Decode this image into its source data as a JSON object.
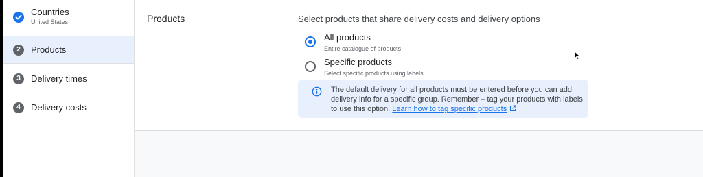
{
  "sidebar": {
    "steps": [
      {
        "label": "Countries",
        "sub": "United States",
        "state": "done",
        "icon": "check-icon"
      },
      {
        "label": "Products",
        "number": "2",
        "state": "active"
      },
      {
        "label": "Delivery times",
        "number": "3",
        "state": "pending"
      },
      {
        "label": "Delivery costs",
        "number": "4",
        "state": "pending"
      }
    ]
  },
  "main": {
    "section_title": "Products",
    "question": "Select products that share delivery costs and delivery options",
    "options": [
      {
        "label": "All products",
        "sub": "Entire catalogue of products",
        "selected": true
      },
      {
        "label": "Specific products",
        "sub": "Select specific products using labels",
        "selected": false
      }
    ],
    "info": {
      "icon": "info-icon",
      "text": "The default delivery for all products must be entered before you can add delivery info for a specific group. Remember – tag your products with labels to use this option.",
      "link": "Learn how to tag specific products",
      "link_icon": "external-link-icon"
    }
  },
  "colors": {
    "accent": "#1a73e8",
    "active_step_bg": "#e8f0fe",
    "info_bg": "#e8f0fe"
  }
}
